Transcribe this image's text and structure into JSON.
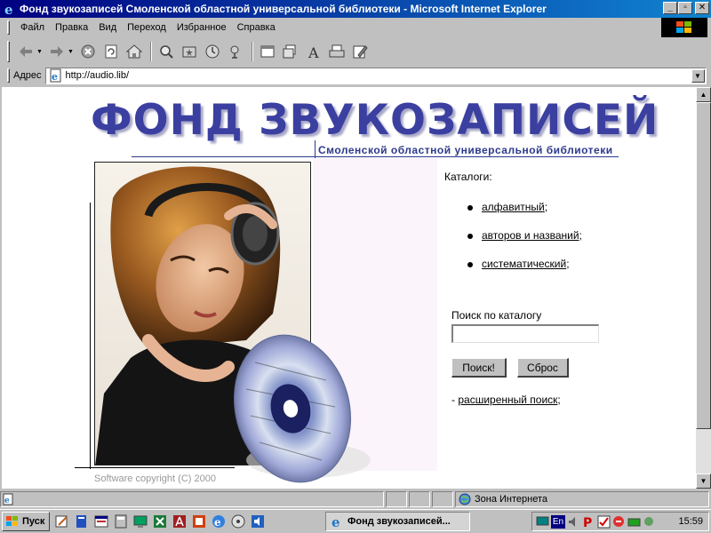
{
  "window": {
    "title": "Фонд звукозаписей Смоленской областной универсальной библиотеки - Microsoft Internet Explorer",
    "minimize": "_",
    "maximize": "▫",
    "close": "✕"
  },
  "menu": {
    "items": [
      {
        "label": "Файл"
      },
      {
        "label": "Правка"
      },
      {
        "label": "Вид"
      },
      {
        "label": "Переход"
      },
      {
        "label": "Избранное"
      },
      {
        "label": "Справка"
      }
    ]
  },
  "toolbar": {
    "icons": [
      "back-arrow-icon",
      "forward-arrow-icon",
      "stop-icon",
      "refresh-icon",
      "home-icon",
      "search-icon",
      "favorites-icon",
      "history-icon",
      "channels-icon",
      "fullscreen-icon",
      "mail-icon",
      "font-icon",
      "print-icon",
      "edit-icon"
    ]
  },
  "address": {
    "label": "Адрес",
    "url": "http://audio.lib/"
  },
  "page": {
    "title": "ФОНД ЗВУКОЗАПИСЕЙ",
    "subtitle": "Смоленской областной универсальной библиотеки",
    "copyright": "Software copyright (C) 2000",
    "catalogs_label": "Каталоги:",
    "catalogs": [
      {
        "link": "алфавитный",
        "suffix": ";"
      },
      {
        "link": "авторов и названий",
        "suffix": ";"
      },
      {
        "link": "систематический",
        "suffix": ";"
      }
    ],
    "search_label": "Поиск по каталогу",
    "search_value": "",
    "search_button": "Поиск!",
    "reset_button": "Сброс",
    "advanced_prefix": "- ",
    "advanced_link": "расширенный поиск",
    "advanced_suffix": ";"
  },
  "status": {
    "zone": "Зона Интернета"
  },
  "taskbar": {
    "start": "Пуск",
    "task": "Фонд звукозаписей...",
    "lang": "En",
    "clock": "15:59"
  },
  "colors": {
    "title_blue": "#3a3fa0",
    "titlebar_start": "#000080",
    "titlebar_end": "#1084d0"
  }
}
